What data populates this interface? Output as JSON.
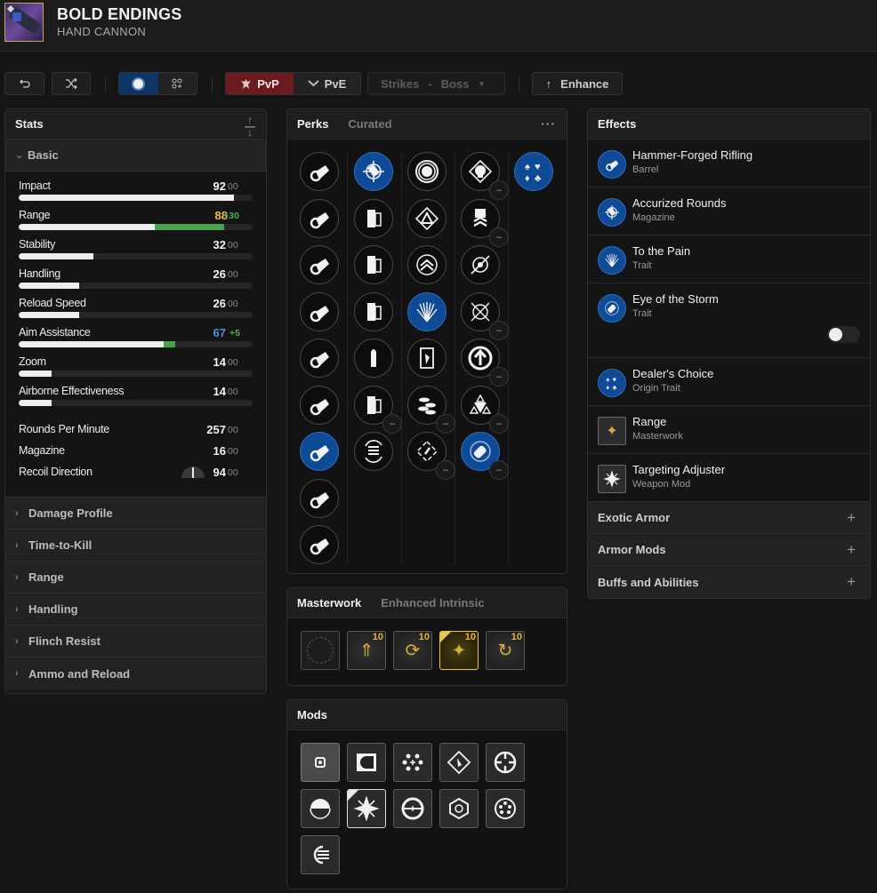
{
  "header": {
    "title": "BOLD ENDINGS",
    "subtitle": "HAND CANNON",
    "weapon_icon": "weapon-thumbnail"
  },
  "toolbar": {
    "undo_icon": "undo-icon",
    "randomize_icon": "shuffle-icon",
    "view_toggle": [
      {
        "icon": "single-circle-icon",
        "active": true
      },
      {
        "icon": "grid-plus-icon",
        "active": false
      }
    ],
    "mode": [
      {
        "label": "PvP",
        "icon": "pvp-crest-icon",
        "active": true
      },
      {
        "label": "PvE",
        "icon": "pve-chevron-icon",
        "active": false
      }
    ],
    "activity": {
      "label": "Strikes",
      "separator": "-",
      "target": "Boss"
    },
    "enhance_label": "Enhance",
    "colors": {
      "pvp_active": "#6b1a1f",
      "view_active": "#0e3566"
    }
  },
  "stats": {
    "title": "Stats",
    "sort_icon": "collapse-arrows-icon",
    "basic_label": "Basic",
    "bars": [
      {
        "label": "Impact",
        "value": "92",
        "extra": "00",
        "base_pct": 92,
        "bonus_pct": 0,
        "color": "#f4f4f4"
      },
      {
        "label": "Range",
        "value": "88",
        "extra": "+30",
        "base_pct": 58,
        "bonus_pct": 30,
        "color": "#f0c23a"
      },
      {
        "label": "Stability",
        "value": "32",
        "extra": "00",
        "base_pct": 32,
        "bonus_pct": 0,
        "color": "#f4f4f4"
      },
      {
        "label": "Handling",
        "value": "26",
        "extra": "00",
        "base_pct": 26,
        "bonus_pct": 0,
        "color": "#f4f4f4"
      },
      {
        "label": "Reload Speed",
        "value": "26",
        "extra": "00",
        "base_pct": 26,
        "bonus_pct": 0,
        "color": "#f4f4f4"
      },
      {
        "label": "Aim Assistance",
        "value": "67",
        "extra": "+5",
        "base_pct": 62,
        "bonus_pct": 5,
        "color": "#4b8fe0"
      },
      {
        "label": "Zoom",
        "value": "14",
        "extra": "00",
        "base_pct": 14,
        "bonus_pct": 0,
        "color": "#f4f4f4"
      },
      {
        "label": "Airborne Effectiveness",
        "value": "14",
        "extra": "00",
        "base_pct": 14,
        "bonus_pct": 0,
        "color": "#f4f4f4"
      }
    ],
    "plain": [
      {
        "label": "Rounds Per Minute",
        "value": "257",
        "extra": "00"
      },
      {
        "label": "Magazine",
        "value": "16",
        "extra": "00"
      },
      {
        "label": "Recoil Direction",
        "value": "94",
        "extra": "00"
      }
    ],
    "sections": [
      "Damage Profile",
      "Time-to-Kill",
      "Range",
      "Handling",
      "Flinch Resist",
      "Ammo and Reload"
    ]
  },
  "perks": {
    "tab_active": "Perks",
    "tab_inactive": "Curated",
    "more_icon": "more-dots-icon",
    "columns": [
      {
        "name": "barrel",
        "items": [
          {
            "icon": "barrel-icon",
            "selected": false
          },
          {
            "icon": "barrel-icon",
            "selected": false
          },
          {
            "icon": "barrel-icon",
            "selected": false
          },
          {
            "icon": "barrel-icon",
            "selected": false
          },
          {
            "icon": "barrel-icon",
            "selected": false
          },
          {
            "icon": "barrel-icon",
            "selected": false
          },
          {
            "icon": "barrel-icon",
            "selected": true
          },
          {
            "icon": "barrel-icon",
            "selected": false
          },
          {
            "icon": "barrel-icon",
            "selected": false
          }
        ]
      },
      {
        "name": "magazine",
        "items": [
          {
            "icon": "crosshair-rounds-icon",
            "selected": true
          },
          {
            "icon": "magazine-icon",
            "selected": false
          },
          {
            "icon": "magazine-icon",
            "selected": false
          },
          {
            "icon": "magazine-icon",
            "selected": false
          },
          {
            "icon": "bullet-icon",
            "selected": false
          },
          {
            "icon": "magazine-icon",
            "selected": false,
            "removable": true
          },
          {
            "icon": "reload-stack-icon",
            "selected": false
          }
        ]
      },
      {
        "name": "trait1",
        "items": [
          {
            "icon": "target-ring-icon",
            "selected": false
          },
          {
            "icon": "triangle-diamond-icon",
            "selected": false
          },
          {
            "icon": "chevron-cycle-icon",
            "selected": false
          },
          {
            "icon": "spikes-icon",
            "selected": true
          },
          {
            "icon": "shard-icon",
            "selected": false
          },
          {
            "icon": "coins-icon",
            "selected": false,
            "removable": true
          },
          {
            "icon": "diamond-cycle-icon",
            "selected": false,
            "removable": true
          }
        ]
      },
      {
        "name": "trait2",
        "items": [
          {
            "icon": "skull-diamond-icon",
            "selected": false,
            "removable": true
          },
          {
            "icon": "totem-icon",
            "selected": false,
            "removable": true
          },
          {
            "icon": "reticle-slash-icon",
            "selected": false
          },
          {
            "icon": "reticle-cross-icon",
            "selected": false,
            "removable": true
          },
          {
            "icon": "arrow-up-circle-icon",
            "selected": false,
            "removable": true
          },
          {
            "icon": "tri-star-icon",
            "selected": false,
            "removable": true
          },
          {
            "icon": "storm-bullet-icon",
            "selected": true,
            "removable": true
          }
        ]
      },
      {
        "name": "origin",
        "items": [
          {
            "icon": "card-suits-icon",
            "selected": true
          }
        ]
      }
    ]
  },
  "masterwork": {
    "tab_active": "Masterwork",
    "tab_inactive": "Enhanced Intrinsic",
    "tiles": [
      {
        "icon": "empty-slot-icon",
        "level": "",
        "active": false
      },
      {
        "icon": "stability-mw-icon",
        "level": "10",
        "active": false
      },
      {
        "icon": "handling-mw-icon",
        "level": "10",
        "active": false
      },
      {
        "icon": "range-mw-icon",
        "level": "10",
        "active": true
      },
      {
        "icon": "reload-mw-icon",
        "level": "10",
        "active": false
      }
    ]
  },
  "mods": {
    "title": "Mods",
    "tiles": [
      {
        "icon": "empty-mod-icon",
        "active": false
      },
      {
        "icon": "half-circle-icon",
        "active": false
      },
      {
        "icon": "dots-plus-icon",
        "active": false
      },
      {
        "icon": "diamond-figure-icon",
        "active": false
      },
      {
        "icon": "crosshair-circle-icon",
        "active": false
      },
      {
        "icon": "fan-dial-icon",
        "active": false
      },
      {
        "icon": "starburst-icon",
        "active": true
      },
      {
        "icon": "dial-plus-icon",
        "active": false
      },
      {
        "icon": "hex-reticle-icon",
        "active": false
      },
      {
        "icon": "revolver-cylinder-icon",
        "active": false
      },
      {
        "icon": "stacked-rounds-icon",
        "active": false
      }
    ]
  },
  "effects": {
    "title": "Effects",
    "items": [
      {
        "name": "Hammer-Forged Rifling",
        "type": "Barrel",
        "icon": "barrel-icon",
        "shape": "round"
      },
      {
        "name": "Accurized Rounds",
        "type": "Magazine",
        "icon": "crosshair-rounds-icon",
        "shape": "round"
      },
      {
        "name": "To the Pain",
        "type": "Trait",
        "icon": "spikes-icon",
        "shape": "round"
      },
      {
        "name": "Eye of the Storm",
        "type": "Trait",
        "icon": "storm-bullet-icon",
        "shape": "round",
        "toggle": false
      },
      {
        "name": "Dealer's Choice",
        "type": "Origin Trait",
        "icon": "card-suits-icon",
        "shape": "round"
      },
      {
        "name": "Range",
        "type": "Masterwork",
        "icon": "range-mw-icon",
        "shape": "square"
      },
      {
        "name": "Targeting Adjuster",
        "type": "Weapon Mod",
        "icon": "starburst-icon",
        "shape": "square"
      }
    ],
    "add_sections": [
      "Exotic Armor",
      "Armor Mods",
      "Buffs and Abilities"
    ]
  }
}
